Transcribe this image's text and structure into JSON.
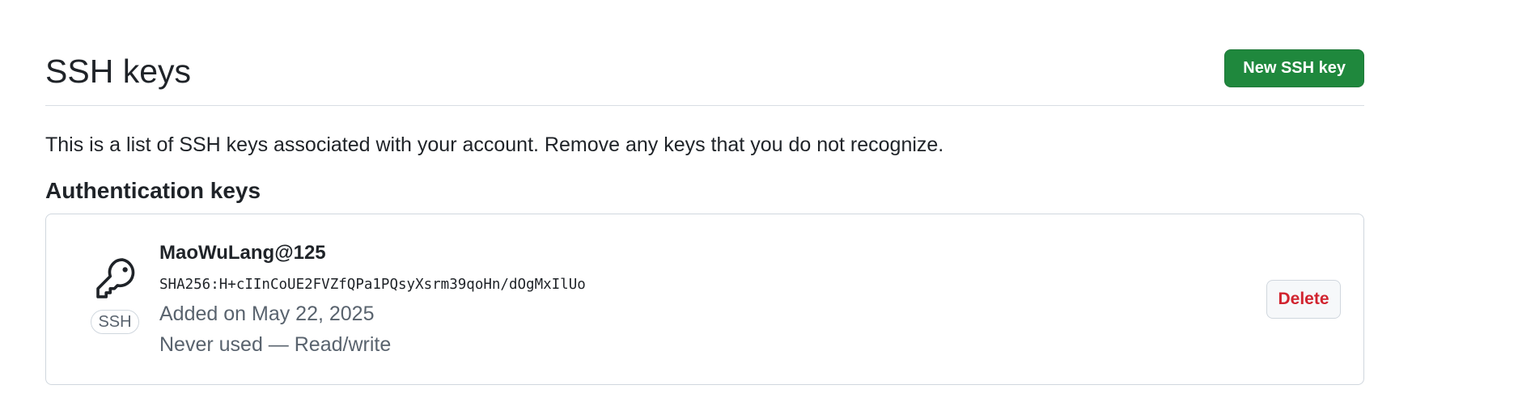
{
  "header": {
    "title": "SSH keys",
    "new_key_button_label": "New SSH key"
  },
  "description": "This is a list of SSH keys associated with your account. Remove any keys that you do not recognize.",
  "authentication_keys": {
    "heading": "Authentication keys",
    "items": [
      {
        "title": "MaoWuLang@125",
        "fingerprint": "SHA256:H+cIInCoUE2FVZfQPa1PQsyXsrm39qoHn/dOgMxIlUo",
        "added": "Added on May 22, 2025",
        "usage": "Never used — Read/write",
        "badge": "SSH",
        "icon": "key-icon",
        "delete_label": "Delete"
      }
    ]
  },
  "colors": {
    "primary_button": "#1f883d",
    "danger_text": "#d1242f",
    "muted_text": "#59636e",
    "border": "#d0d7de"
  }
}
